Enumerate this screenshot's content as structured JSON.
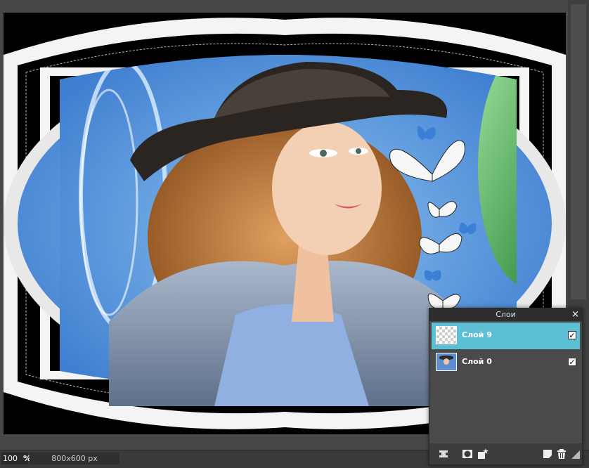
{
  "status": {
    "zoom_value": "100",
    "zoom_unit": "%",
    "image_size": "800x600 px"
  },
  "layers_panel": {
    "title": "Слои",
    "close_glyph": "×",
    "layers": [
      {
        "name": "Слой 9",
        "visible": true,
        "active": true,
        "thumb": "transparent"
      },
      {
        "name": "Слой 0",
        "visible": true,
        "active": false,
        "thumb": "image"
      }
    ],
    "check_glyph": "✓",
    "toolbar_icons": [
      "layer-settings-icon",
      "mask-icon",
      "effects-icon",
      "new-layer-icon",
      "delete-layer-icon",
      "resize-icon"
    ]
  },
  "colors": {
    "accent": "#5dbfd3",
    "panel_bg": "#4a4a4a",
    "workspace_bg": "#474747"
  }
}
